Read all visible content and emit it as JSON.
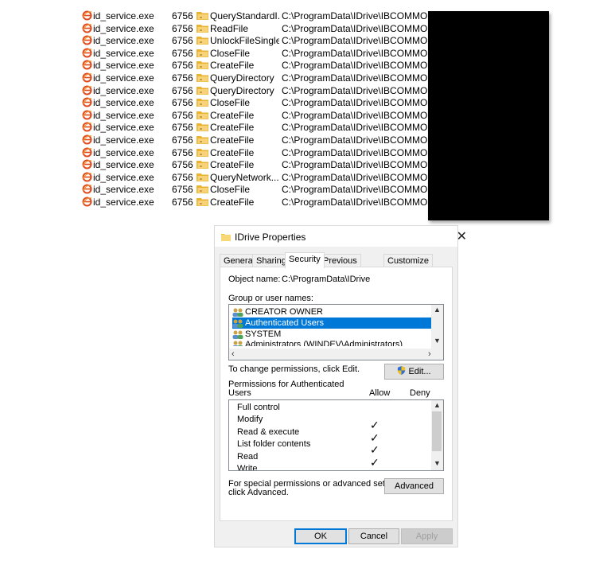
{
  "log": {
    "rows": [
      {
        "process": "id_service.exe",
        "pid": "6756",
        "operation": "QueryStandardI...",
        "path": "C:\\ProgramData\\IDrive\\IBCOMMON\\"
      },
      {
        "process": "id_service.exe",
        "pid": "6756",
        "operation": "ReadFile",
        "path": "C:\\ProgramData\\IDrive\\IBCOMMON\\"
      },
      {
        "process": "id_service.exe",
        "pid": "6756",
        "operation": "UnlockFileSingle",
        "path": "C:\\ProgramData\\IDrive\\IBCOMMON\\"
      },
      {
        "process": "id_service.exe",
        "pid": "6756",
        "operation": "CloseFile",
        "path": "C:\\ProgramData\\IDrive\\IBCOMMON\\"
      },
      {
        "process": "id_service.exe",
        "pid": "6756",
        "operation": "CreateFile",
        "path": "C:\\ProgramData\\IDrive\\IBCOMMON"
      },
      {
        "process": "id_service.exe",
        "pid": "6756",
        "operation": "QueryDirectory",
        "path": "C:\\ProgramData\\IDrive\\IBCOMMON\\"
      },
      {
        "process": "id_service.exe",
        "pid": "6756",
        "operation": "QueryDirectory",
        "path": "C:\\ProgramData\\IDrive\\IBCOMMON"
      },
      {
        "process": "id_service.exe",
        "pid": "6756",
        "operation": "CloseFile",
        "path": "C:\\ProgramData\\IDrive\\IBCOMMON"
      },
      {
        "process": "id_service.exe",
        "pid": "6756",
        "operation": "CreateFile",
        "path": "C:\\ProgramData\\IDrive\\IBCOMMON\\"
      },
      {
        "process": "id_service.exe",
        "pid": "6756",
        "operation": "CreateFile",
        "path": "C:\\ProgramData\\IDrive\\IBCOMMON\\"
      },
      {
        "process": "id_service.exe",
        "pid": "6756",
        "operation": "CreateFile",
        "path": "C:\\ProgramData\\IDrive\\IBCOMMON\\"
      },
      {
        "process": "id_service.exe",
        "pid": "6756",
        "operation": "CreateFile",
        "path": "C:\\ProgramData\\IDrive\\IBCOMMON\\"
      },
      {
        "process": "id_service.exe",
        "pid": "6756",
        "operation": "CreateFile",
        "path": "C:\\ProgramData\\IDrive\\IBCOMMON\\"
      },
      {
        "process": "id_service.exe",
        "pid": "6756",
        "operation": "QueryNetwork...",
        "path": "C:\\ProgramData\\IDrive\\IBCOMMON\\"
      },
      {
        "process": "id_service.exe",
        "pid": "6756",
        "operation": "CloseFile",
        "path": "C:\\ProgramData\\IDrive\\IBCOMMON\\"
      },
      {
        "process": "id_service.exe",
        "pid": "6756",
        "operation": "CreateFile",
        "path": "C:\\ProgramData\\IDrive\\IBCOMMON\\"
      }
    ],
    "process_icon": "ie-process-icon",
    "operation_icon": "filesystem-folder-icon",
    "redaction_color": "#000000"
  },
  "dialog": {
    "title": "IDrive Properties",
    "close_glyph": "✕",
    "tabs": [
      "General",
      "Sharing",
      "Security",
      "Previous Versions",
      "Customize"
    ],
    "active_tab": "Security",
    "object_name_label": "Object name:",
    "object_name_value": "C:\\ProgramData\\IDrive",
    "group_label": "Group or user names:",
    "users": [
      "CREATOR OWNER",
      "Authenticated Users",
      "SYSTEM",
      "Administrators (WINDEV\\Administrators)"
    ],
    "selected_user": "Authenticated Users",
    "change_text": "To change permissions, click Edit.",
    "edit_button": "Edit...",
    "permissions_for_line1": "Permissions for Authenticated",
    "permissions_for_line2": "Users",
    "allow_header": "Allow",
    "deny_header": "Deny",
    "permissions": [
      {
        "name": "Full control",
        "allow": false,
        "deny": false
      },
      {
        "name": "Modify",
        "allow": true,
        "deny": false
      },
      {
        "name": "Read & execute",
        "allow": true,
        "deny": false
      },
      {
        "name": "List folder contents",
        "allow": true,
        "deny": false
      },
      {
        "name": "Read",
        "allow": true,
        "deny": false
      },
      {
        "name": "Write",
        "allow": true,
        "deny": false
      }
    ],
    "check_glyph": "✓",
    "special_line1": "For special permissions or advanced settings,",
    "special_line2": "click Advanced.",
    "advanced_button": "Advanced",
    "ok_button": "OK",
    "cancel_button": "Cancel",
    "apply_button": "Apply",
    "selection_color": "#0078d7"
  }
}
